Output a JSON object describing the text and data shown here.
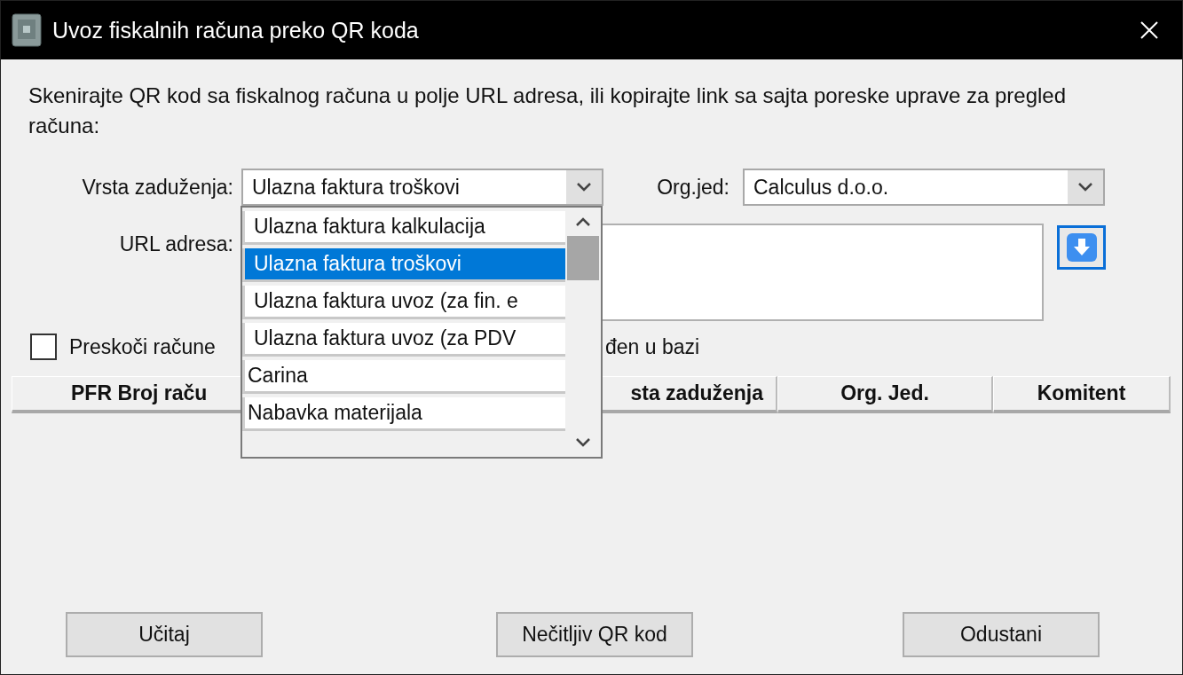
{
  "window": {
    "title": "Uvoz fiskalnih računa preko QR koda"
  },
  "instructions": "Skenirajte QR kod sa fiskalnog računa u polje URL adresa, ili kopirajte link sa sajta poreske uprave za pregled računa:",
  "charge_type": {
    "label": "Vrsta zaduženja:",
    "value": "Ulazna faktura troškovi",
    "expanded": true
  },
  "org_unit": {
    "label": "Org.jed:",
    "value": "Calculus d.o.o."
  },
  "url": {
    "label": "URL adresa:"
  },
  "dropdown": {
    "items": [
      {
        "label": "Ulazna faktura kalkulacija",
        "selected": false
      },
      {
        "label": "Ulazna faktura troškovi",
        "selected": true
      },
      {
        "label": "Ulazna faktura uvoz (za fin. e",
        "selected": false
      },
      {
        "label": "Ulazna faktura uvoz (za PDV",
        "selected": false
      },
      {
        "label": "Carina",
        "selected": false
      },
      {
        "label": "Nabavka materijala",
        "selected": false
      }
    ]
  },
  "skip_checkbox": {
    "label": "Preskoči račune",
    "label_tail": "đen u bazi",
    "checked": false
  },
  "table": {
    "columns": [
      "PFR Broj raču",
      "sta zaduženja",
      "Org. Jed.",
      "Komitent"
    ]
  },
  "buttons": [
    "Učitaj",
    "Nečitljiv QR kod",
    "Odustani"
  ]
}
